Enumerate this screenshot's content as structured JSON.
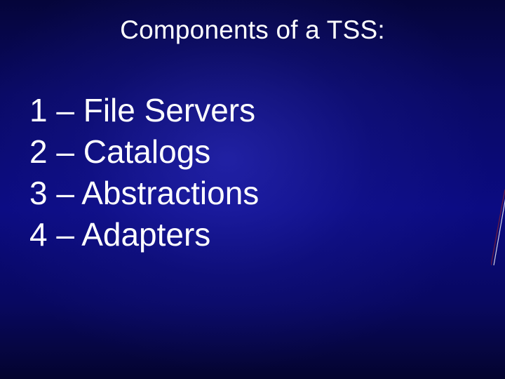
{
  "slide": {
    "title": "Components of a TSS:",
    "items": [
      "1 – File Servers",
      "2 – Catalogs",
      "3 – Abstractions",
      "4 – Adapters"
    ]
  }
}
